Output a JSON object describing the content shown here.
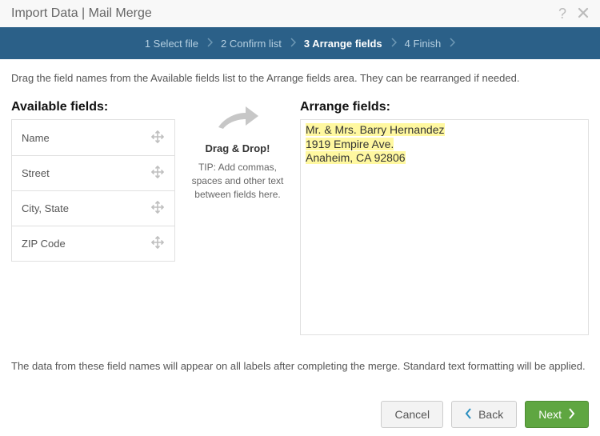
{
  "header": {
    "title": "Import Data | Mail Merge"
  },
  "steps": {
    "items": [
      {
        "label": "1 Select file"
      },
      {
        "label": "2 Confirm list"
      },
      {
        "label": "3 Arrange fields"
      },
      {
        "label": "4 Finish"
      }
    ],
    "active_index": 2
  },
  "instruction": "Drag the field names from the Available fields list to the Arrange fields area. They can be rearranged if needed.",
  "available": {
    "heading": "Available fields:",
    "items": [
      {
        "label": "Name"
      },
      {
        "label": "Street"
      },
      {
        "label": "City, State"
      },
      {
        "label": "ZIP Code"
      }
    ]
  },
  "mid": {
    "title": "Drag & Drop!",
    "tip": "TIP: Add commas, spaces and other text between fields here."
  },
  "arrange": {
    "heading": "Arrange fields:",
    "lines": [
      "Mr. & Mrs. Barry Hernandez",
      "1919 Empire Ave.",
      "Anaheim, CA  92806"
    ]
  },
  "footer_note": "The data from these field names will appear on all labels after completing the merge. Standard text formatting will be applied.",
  "buttons": {
    "cancel": "Cancel",
    "back": "Back",
    "next": "Next"
  }
}
